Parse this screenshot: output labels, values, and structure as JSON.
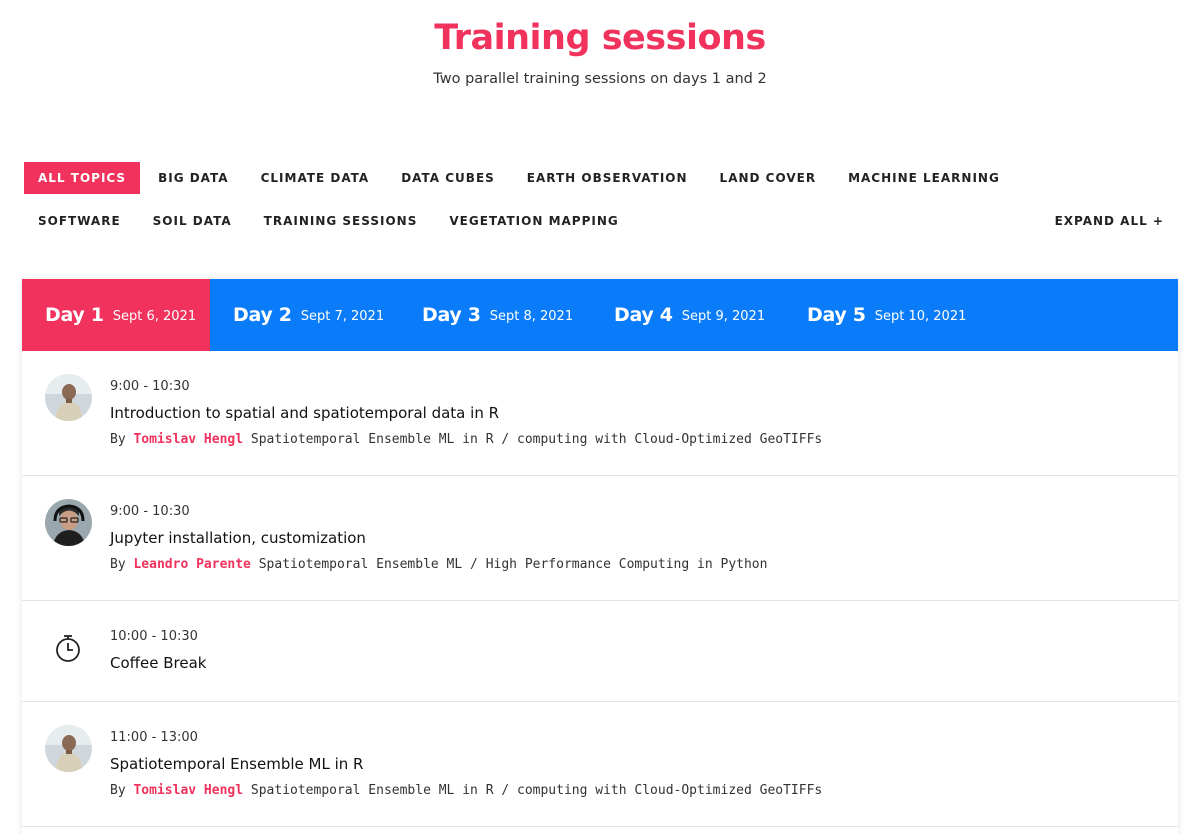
{
  "header": {
    "title": "Training sessions",
    "subtitle": "Two parallel training sessions on days 1 and 2"
  },
  "filters": {
    "row1": [
      "ALL TOPICS",
      "BIG DATA",
      "CLIMATE DATA",
      "DATA CUBES",
      "EARTH OBSERVATION",
      "LAND COVER",
      "MACHINE LEARNING"
    ],
    "row2": [
      "SOFTWARE",
      "SOIL DATA",
      "TRAINING SESSIONS",
      "VEGETATION MAPPING"
    ],
    "active": "ALL TOPICS",
    "expand_all": "EXPAND ALL +"
  },
  "colors": {
    "accent": "#f0325c",
    "tabs_blue": "#0a7cf9"
  },
  "days": [
    {
      "label": "Day 1",
      "date": "Sept 6, 2021",
      "active": true
    },
    {
      "label": "Day 2",
      "date": "Sept 7, 2021",
      "active": false
    },
    {
      "label": "Day 3",
      "date": "Sept 8, 2021",
      "active": false
    },
    {
      "label": "Day 4",
      "date": "Sept 9, 2021",
      "active": false
    },
    {
      "label": "Day 5",
      "date": "Sept 10, 2021",
      "active": false
    }
  ],
  "sessions": [
    {
      "time": "9:00 - 10:30",
      "title": "Introduction to spatial and spatiotemporal data in R",
      "by": "By",
      "speaker": "Tomislav Hengl",
      "topic": "Spatiotemporal Ensemble ML in R / computing with Cloud-Optimized GeoTIFFs",
      "icon": "avatar"
    },
    {
      "time": "9:00 - 10:30",
      "title": "Jupyter installation, customization",
      "by": "By",
      "speaker": "Leandro Parente",
      "topic": "Spatiotemporal Ensemble ML / High Performance Computing in Python",
      "icon": "avatar"
    },
    {
      "time": "10:00 - 10:30",
      "title": "Coffee Break",
      "icon": "stopwatch-icon"
    },
    {
      "time": "11:00 - 13:00",
      "title": "Spatiotemporal Ensemble ML in R",
      "by": "By",
      "speaker": "Tomislav Hengl",
      "topic": "Spatiotemporal Ensemble ML in R / computing with Cloud-Optimized GeoTIFFs",
      "icon": "avatar"
    }
  ]
}
